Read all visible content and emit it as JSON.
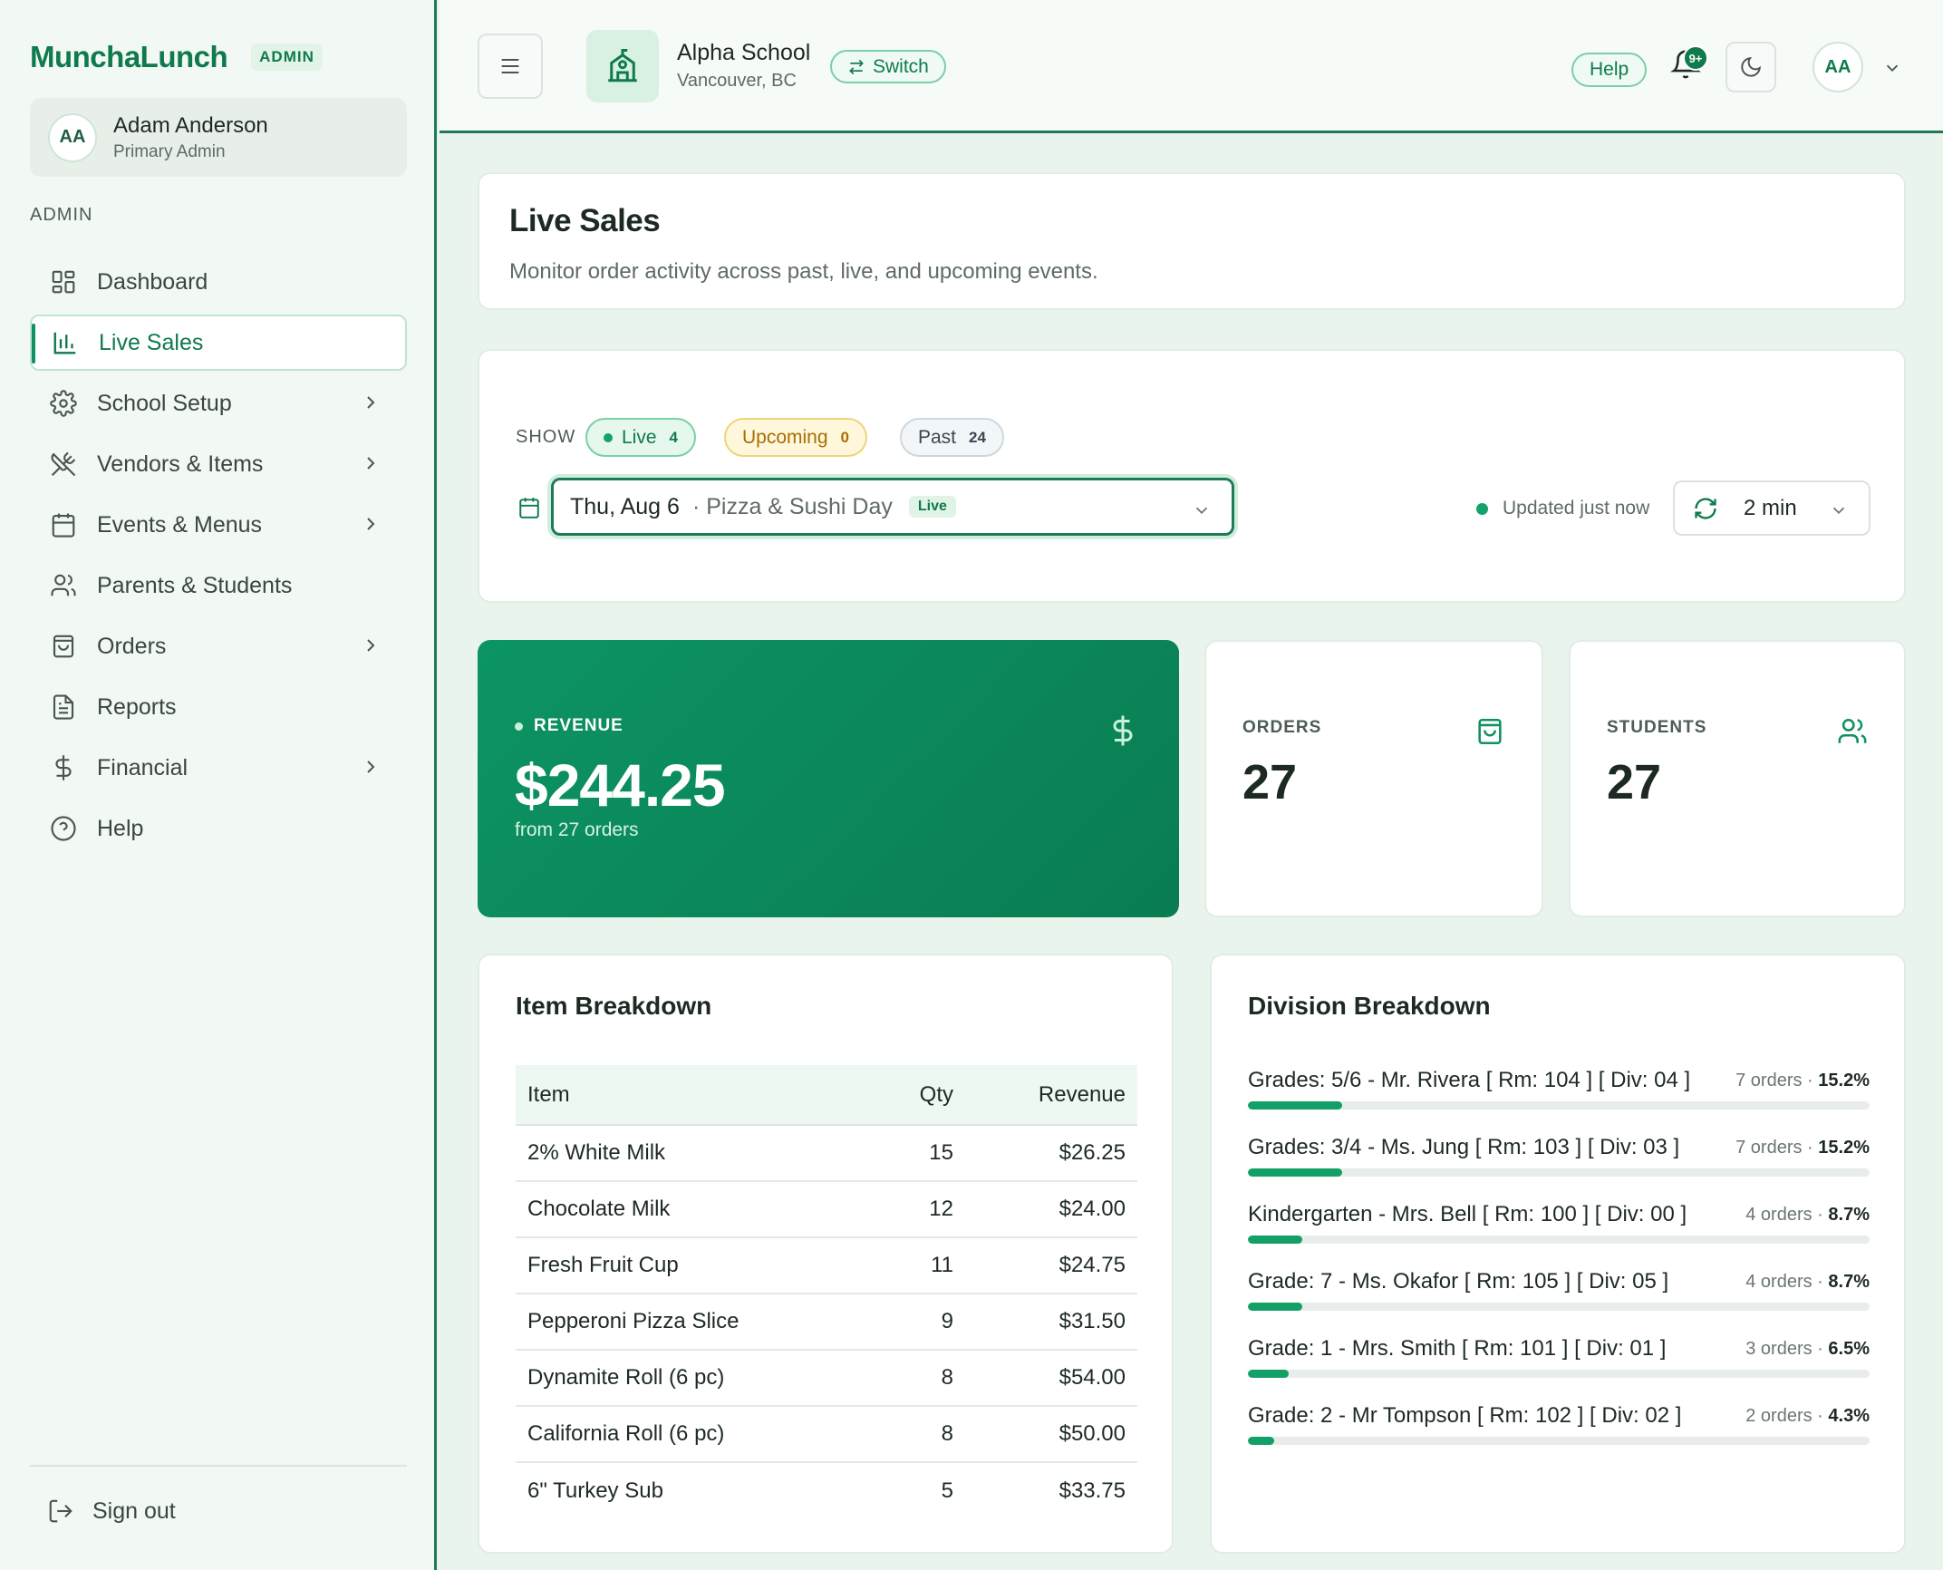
{
  "brand": {
    "name": "MunchaLunch",
    "tag": "ADMIN"
  },
  "user": {
    "initials": "AA",
    "name": "Adam Anderson",
    "role": "Primary Admin"
  },
  "sidebar": {
    "section_label": "ADMIN",
    "items": [
      {
        "label": "Dashboard",
        "icon": "dashboard-icon",
        "has_children": false,
        "active": false
      },
      {
        "label": "Live Sales",
        "icon": "bar-chart-icon",
        "has_children": false,
        "active": true
      },
      {
        "label": "School Setup",
        "icon": "gear-icon",
        "has_children": true,
        "active": false
      },
      {
        "label": "Vendors & Items",
        "icon": "utensils-crossed-icon",
        "has_children": true,
        "active": false
      },
      {
        "label": "Events & Menus",
        "icon": "calendar-icon",
        "has_children": true,
        "active": false
      },
      {
        "label": "Parents & Students",
        "icon": "users-icon",
        "has_children": false,
        "active": false
      },
      {
        "label": "Orders",
        "icon": "shopping-bag-icon",
        "has_children": true,
        "active": false
      },
      {
        "label": "Reports",
        "icon": "document-icon",
        "has_children": false,
        "active": false
      },
      {
        "label": "Financial",
        "icon": "dollar-icon",
        "has_children": true,
        "active": false
      },
      {
        "label": "Help",
        "icon": "help-circle-icon",
        "has_children": false,
        "active": false
      }
    ],
    "signout_label": "Sign out"
  },
  "topbar": {
    "school_name": "Alpha School",
    "school_location": "Vancouver, BC",
    "switch_label": "Switch",
    "help_label": "Help",
    "notifications_badge": "9+",
    "avatar_initials": "AA"
  },
  "page": {
    "title": "Live Sales",
    "subtitle": "Monitor order activity across past, live, and upcoming events."
  },
  "filters": {
    "show_label": "SHOW",
    "live": {
      "label": "Live",
      "count": "4"
    },
    "upcoming": {
      "label": "Upcoming",
      "count": "0"
    },
    "past": {
      "label": "Past",
      "count": "24"
    },
    "event": {
      "date": "Thu, Aug 6",
      "name": "· Pizza & Sushi Day",
      "status": "Live"
    },
    "updated_text": "Updated just now",
    "refresh_interval": "2 min"
  },
  "stats": {
    "revenue": {
      "label": "REVENUE",
      "value": "$244.25",
      "sub": "from 27 orders"
    },
    "orders": {
      "label": "ORDERS",
      "value": "27"
    },
    "students": {
      "label": "STUDENTS",
      "value": "27"
    }
  },
  "item_breakdown": {
    "title": "Item Breakdown",
    "columns": [
      "Item",
      "Qty",
      "Revenue"
    ],
    "rows": [
      [
        "2% White Milk",
        "15",
        "$26.25"
      ],
      [
        "Chocolate Milk",
        "12",
        "$24.00"
      ],
      [
        "Fresh Fruit Cup",
        "11",
        "$24.75"
      ],
      [
        "Pepperoni Pizza Slice",
        "9",
        "$31.50"
      ],
      [
        "Dynamite Roll (6 pc)",
        "8",
        "$54.00"
      ],
      [
        "California Roll (6 pc)",
        "8",
        "$50.00"
      ],
      [
        "6\" Turkey Sub",
        "5",
        "$33.75"
      ]
    ]
  },
  "division_breakdown": {
    "title": "Division Breakdown",
    "rows": [
      {
        "name": "Grades: 5/6 - Mr. Rivera [ Rm: 104 ] [ Div: 04 ]",
        "orders": "7 orders ·",
        "pct": "15.2%",
        "fraction": 0.152
      },
      {
        "name": "Grades: 3/4 - Ms. Jung [ Rm: 103 ] [ Div: 03 ]",
        "orders": "7 orders ·",
        "pct": "15.2%",
        "fraction": 0.152
      },
      {
        "name": "Kindergarten - Mrs. Bell [ Rm: 100 ] [ Div: 00 ]",
        "orders": "4 orders ·",
        "pct": "8.7%",
        "fraction": 0.087
      },
      {
        "name": "Grade: 7 - Ms. Okafor [ Rm: 105 ] [ Div: 05 ]",
        "orders": "4 orders ·",
        "pct": "8.7%",
        "fraction": 0.087
      },
      {
        "name": "Grade: 1 - Mrs. Smith [ Rm: 101 ] [ Div: 01 ]",
        "orders": "3 orders ·",
        "pct": "6.5%",
        "fraction": 0.065
      },
      {
        "name": "Grade: 2 - Mr Tompson [ Rm: 102 ] [ Div: 02 ]",
        "orders": "2 orders ·",
        "pct": "4.3%",
        "fraction": 0.043
      }
    ]
  },
  "colors": {
    "brand": "#0f7a4c",
    "accent": "#12a066",
    "upcoming": "#a86d00"
  }
}
